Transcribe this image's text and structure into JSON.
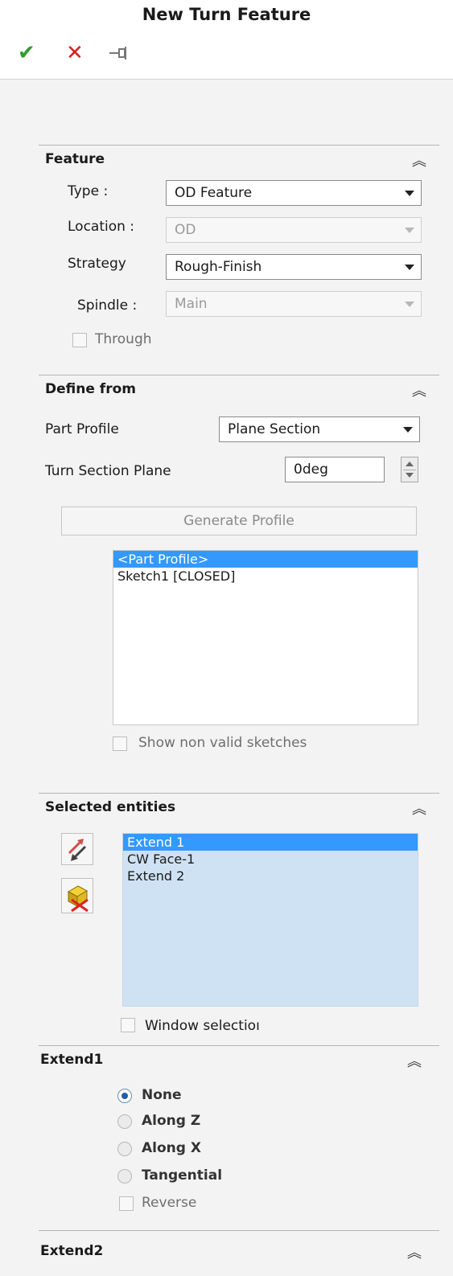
{
  "title": "New Turn Feature",
  "toolbar": {
    "ok_icon": "check-icon",
    "cancel_icon": "close-icon",
    "pin_icon": "pushpin-icon"
  },
  "feature": {
    "title": "Feature",
    "type_label": "Type :",
    "type_value": "OD Feature",
    "location_label": "Location :",
    "location_value": "OD",
    "strategy_label": "Strategy",
    "strategy_value": "Rough-Finish",
    "spindle_label": "Spindle :",
    "spindle_value": "Main",
    "through_label": "Through"
  },
  "define_from": {
    "title": "Define from",
    "part_profile_label": "Part Profile",
    "part_profile_value": "Plane Section",
    "turn_section_plane_label": "Turn Section Plane",
    "turn_section_plane_value": "0deg",
    "generate_button": "Generate Profile",
    "list": [
      "<Part Profile>",
      "Sketch1 [CLOSED]"
    ],
    "show_non_valid_label": "Show non valid sketches"
  },
  "selected_entities": {
    "title": "Selected entities",
    "list": [
      "Extend 1",
      "CW Face-1",
      "Extend 2"
    ],
    "window_selection_label": "Window selectioı",
    "swap_icon": "swap-arrows-icon",
    "delete_icon": "delete-face-icon"
  },
  "extend1": {
    "title": "Extend1",
    "options": [
      "None",
      "Along Z",
      "Along X",
      "Tangential"
    ],
    "selected": "None",
    "reverse_label": "Reverse"
  },
  "extend2": {
    "title": "Extend2"
  },
  "colors": {
    "accent": "#3399ff",
    "ok": "#2e9e2e",
    "cancel": "#d62020",
    "list_blue": "#cfe2f3"
  }
}
